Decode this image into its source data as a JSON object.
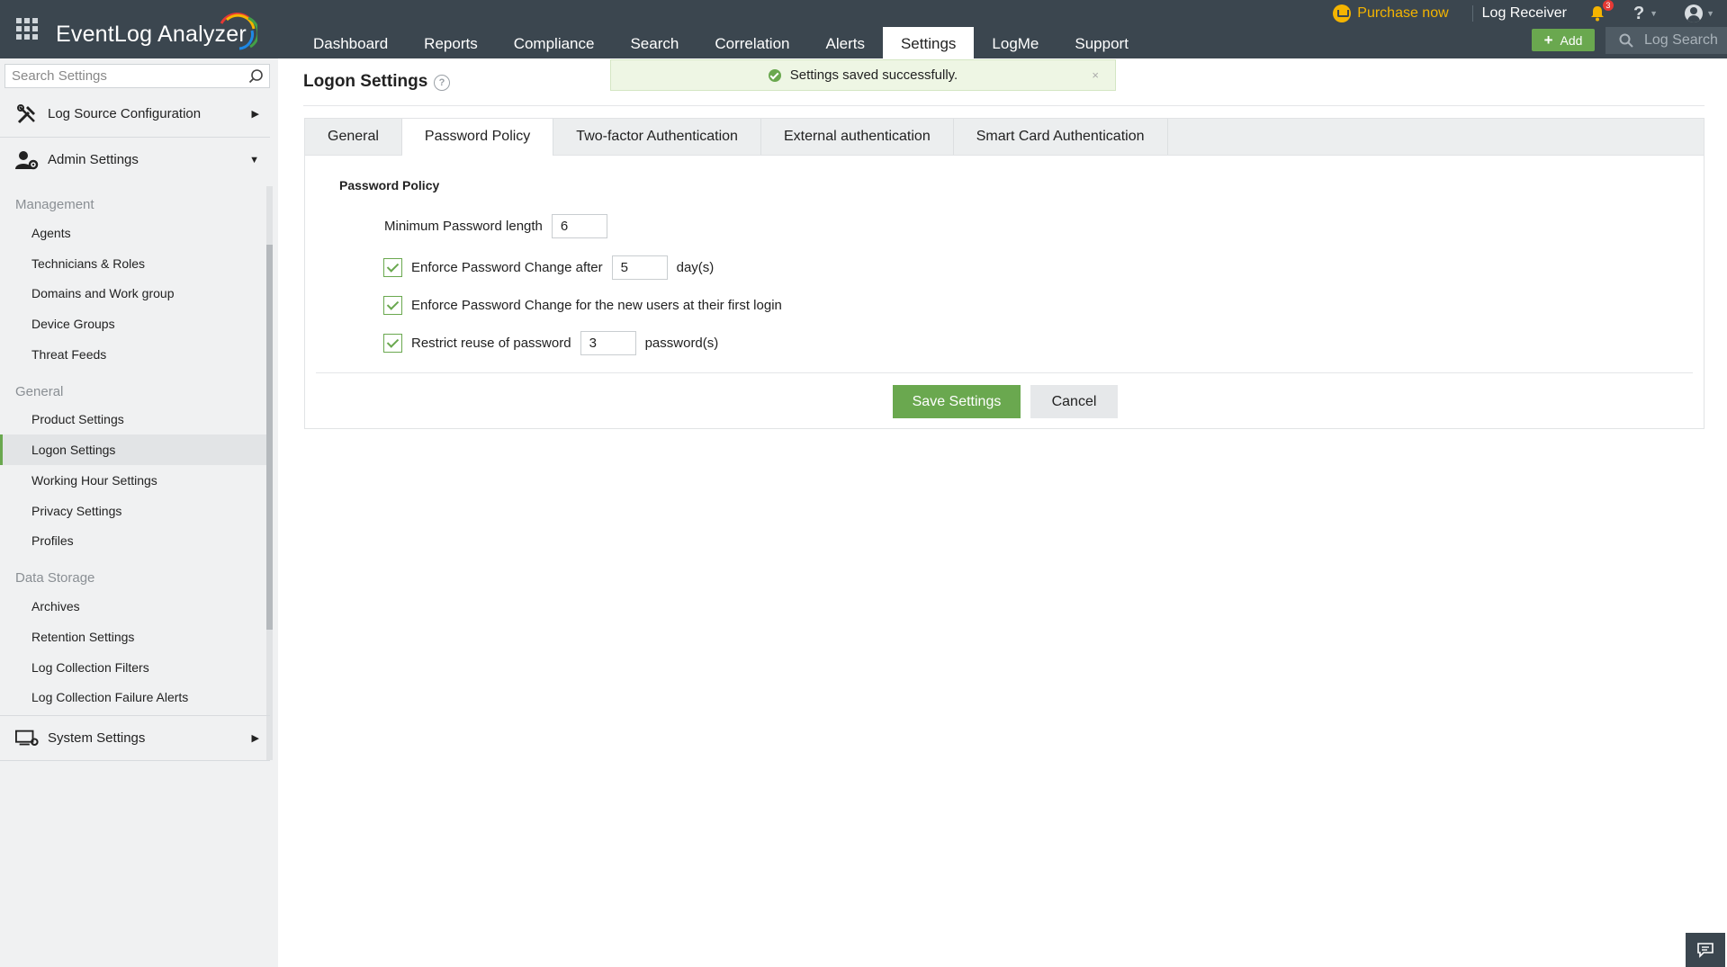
{
  "app": {
    "name": "EventLog Analyzer"
  },
  "nav": {
    "tabs": [
      {
        "label": "Dashboard"
      },
      {
        "label": "Reports"
      },
      {
        "label": "Compliance"
      },
      {
        "label": "Search"
      },
      {
        "label": "Correlation"
      },
      {
        "label": "Alerts"
      },
      {
        "label": "Settings",
        "active": true
      },
      {
        "label": "LogMe"
      },
      {
        "label": "Support"
      }
    ]
  },
  "header": {
    "purchase_label": "Purchase now",
    "log_receiver_label": "Log Receiver",
    "notification_count": "3",
    "help_label": "?",
    "add_label": "Add",
    "log_search_placeholder": "Log Search"
  },
  "sidebar": {
    "search_placeholder": "Search Settings",
    "sections": {
      "log_source": "Log Source Configuration",
      "admin": "Admin Settings",
      "system": "System Settings"
    },
    "groups": {
      "management": {
        "label": "Management",
        "items": [
          "Agents",
          "Technicians & Roles",
          "Domains and Work group",
          "Device Groups",
          "Threat Feeds"
        ]
      },
      "general": {
        "label": "General",
        "items": [
          "Product Settings",
          "Logon Settings",
          "Working Hour Settings",
          "Privacy Settings",
          "Profiles"
        ]
      },
      "data_storage": {
        "label": "Data Storage",
        "items": [
          "Archives",
          "Retention Settings",
          "Log Collection Filters",
          "Log Collection Failure Alerts"
        ]
      }
    },
    "active_item": "Logon Settings"
  },
  "page": {
    "title": "Logon Settings"
  },
  "toast": {
    "message": "Settings saved successfully.",
    "close": "×"
  },
  "tabs": [
    "General",
    "Password Policy",
    "Two-factor Authentication",
    "External authentication",
    "Smart Card Authentication"
  ],
  "active_tab": "Password Policy",
  "password_policy": {
    "heading": "Password Policy",
    "min_length_label": "Minimum Password length",
    "min_length_value": "6",
    "enforce_change_label": "Enforce Password Change after",
    "enforce_change_value": "5",
    "enforce_change_unit": "day(s)",
    "enforce_change_checked": true,
    "first_login_label": "Enforce Password Change for the new users at their first login",
    "first_login_checked": true,
    "reuse_label": "Restrict reuse of password",
    "reuse_value": "3",
    "reuse_unit": "password(s)",
    "reuse_checked": true
  },
  "actions": {
    "save_label": "Save Settings",
    "cancel_label": "Cancel"
  },
  "colors": {
    "topbar": "#3b464f",
    "accent_green": "#6aa84f",
    "purchase": "#f4b400",
    "sidebar_bg": "#f0f1f2"
  }
}
